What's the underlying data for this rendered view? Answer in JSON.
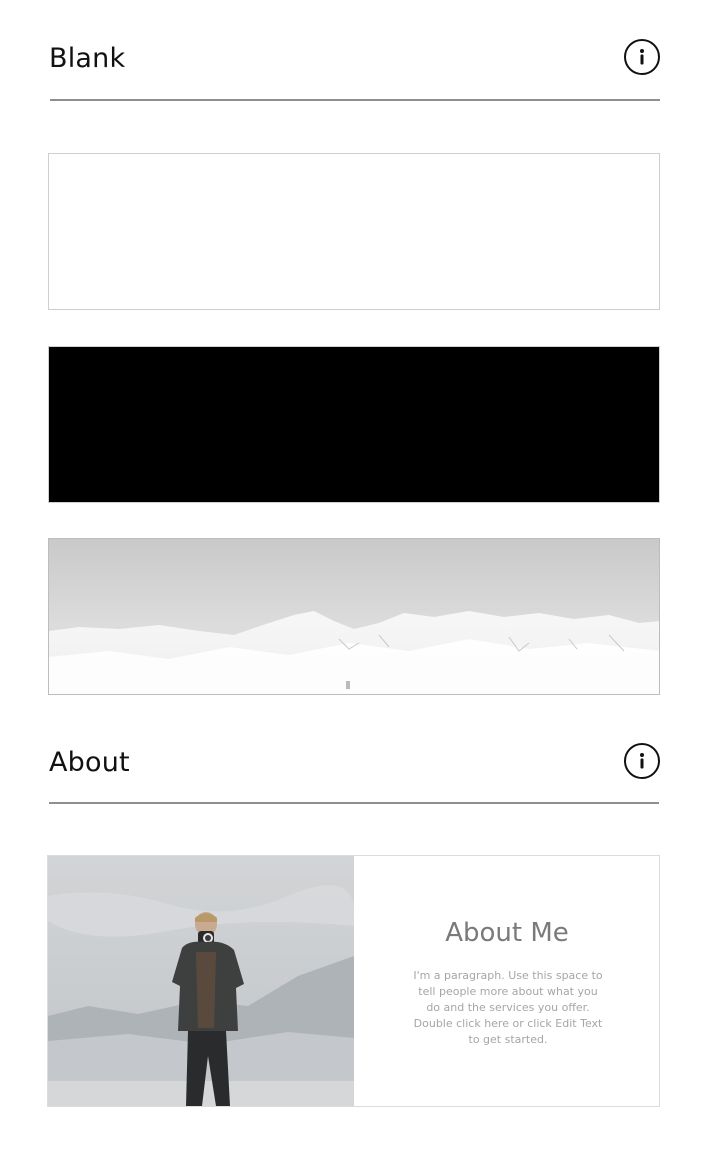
{
  "sections": [
    {
      "title": "Blank",
      "info_icon": "info-icon"
    },
    {
      "title": "About",
      "info_icon": "info-icon"
    }
  ],
  "presets": [
    {
      "name": "white-strip",
      "color": "#ffffff"
    },
    {
      "name": "black-strip",
      "color": "#000000"
    },
    {
      "name": "mountain-strip",
      "image": "snowy-mountains"
    }
  ],
  "about_card": {
    "image": "photographer-with-camera",
    "heading": "About Me",
    "paragraph": "I'm a paragraph. Use this space to tell people more about what you do and the services you offer. Double click here or click Edit Text to get started."
  },
  "colors": {
    "text": "#111111",
    "divider": "#8f8f8f",
    "card_border": "#cfcfcf",
    "about_heading": "#7a7a7a",
    "about_paragraph": "#a6a6a6"
  }
}
